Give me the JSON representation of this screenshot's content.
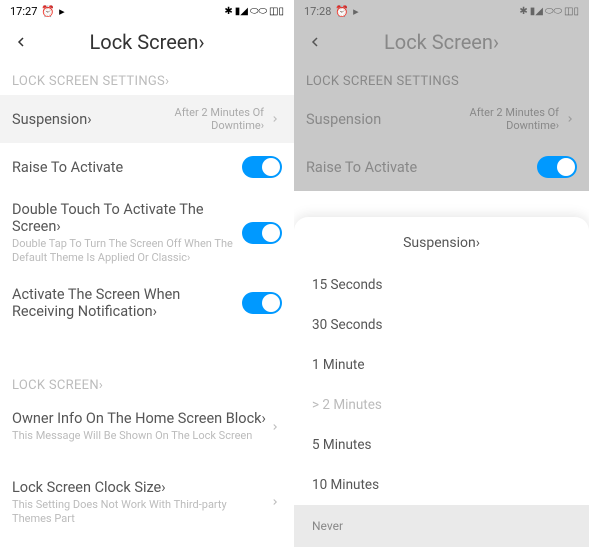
{
  "left": {
    "status": {
      "time": "17:27",
      "alarm": "⏰",
      "youtube": "▸",
      "bt": "✱",
      "signal": "▮◢",
      "wifi": "⬭⬭",
      "battery": "◫▯"
    },
    "header": {
      "title": "Lock Screen›"
    },
    "section1": "LOCK SCREEN SETTINGS›",
    "rows": {
      "suspension": {
        "title": "Suspension›",
        "value": "After 2 Minutes Of\nDowntime›"
      },
      "raise": {
        "title": "Raise To Activate"
      },
      "doubletap": {
        "title": "Double Touch To Activate The Screen›",
        "sub": "Double Tap To Turn The Screen Off When The Default Theme Is Applied Or Classic›"
      },
      "notif": {
        "title": "Activate The Screen When Receiving Notification›"
      }
    },
    "section2": "LOCK SCREEN›",
    "rows2": {
      "owner": {
        "title": "Owner Info On The Home Screen Block›",
        "sub": "This Message Will Be Shown On The Lock Screen"
      },
      "clock": {
        "title": "Lock Screen Clock Size›",
        "sub": "This Setting Does Not Work With Third-party Themes Part"
      }
    }
  },
  "right": {
    "status": {
      "time": "17:28",
      "alarm": "⏰",
      "youtube": "▸",
      "bt": "✱",
      "signal": "▮◢",
      "wifi": "⬭⬭",
      "battery": "◫▯"
    },
    "header": {
      "title": "Lock Screen›"
    },
    "section1": "LOCK SCREEN SETTINGS",
    "rows": {
      "suspension": {
        "title": "Suspension",
        "value": "After 2 Minutes Of\nDowntime›"
      },
      "raise": {
        "title": "Raise To Activate"
      }
    },
    "sheet": {
      "title": "Suspension›",
      "options": [
        "15 Seconds",
        "30 Seconds",
        "1 Minute",
        "> 2 Minutes",
        "5 Minutes",
        "10 Minutes",
        "Never"
      ],
      "selected_index": 3
    }
  },
  "colors": {
    "accent": "#0099ff"
  }
}
